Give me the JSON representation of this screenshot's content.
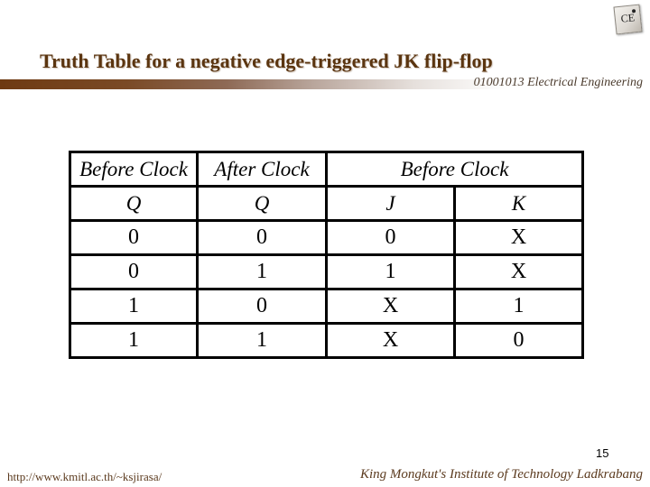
{
  "logo": {
    "icon": "ce-chip-logo",
    "text": "CE"
  },
  "slide": {
    "title": "Truth Table for a negative edge-triggered JK flip-flop",
    "course": "01001013 Electrical Engineering",
    "page_number": "15"
  },
  "table": {
    "group_headers": [
      "Before Clock",
      "After Clock",
      "Before Clock"
    ],
    "column_headers": [
      "Q",
      "Q",
      "J",
      "K"
    ],
    "rows": [
      [
        "0",
        "0",
        "0",
        "X"
      ],
      [
        "0",
        "1",
        "1",
        "X"
      ],
      [
        "1",
        "0",
        "X",
        "1"
      ],
      [
        "1",
        "1",
        "X",
        "0"
      ]
    ]
  },
  "footer": {
    "url": "http://www.kmitl.ac.th/~ksjirasa/",
    "institution": "King Mongkut's Institute of Technology Ladkrabang"
  },
  "colors": {
    "title": "#5b3510",
    "bar_start": "#6e3a12",
    "footer_text": "#5b3a1e"
  }
}
